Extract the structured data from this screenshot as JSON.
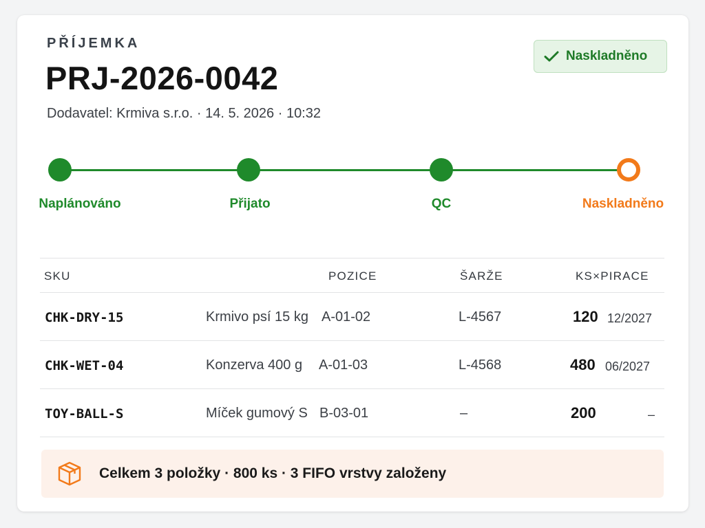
{
  "header": {
    "eyebrow": "PŘÍJEMKA",
    "doc_number": "PRJ-2026-0042",
    "subtitle": "Dodavatel: Krmiva s.r.o. · 14. 5. 2026 · 10:32",
    "status_badge": {
      "label": "Naskladněno",
      "icon": "check-icon",
      "color": "#1e7a27",
      "background": "#e6f4e6"
    }
  },
  "progress": {
    "done_color": "#1f8a2b",
    "current_color": "#f27a1a",
    "steps": [
      {
        "label": "Naplánováno",
        "state": "done"
      },
      {
        "label": "Přijato",
        "state": "done"
      },
      {
        "label": "QC",
        "state": "done"
      },
      {
        "label": "Naskladněno",
        "state": "current"
      }
    ]
  },
  "table": {
    "columns": [
      "SKU",
      "POZICE",
      "ŠARŽE",
      "KS×PIRACE"
    ],
    "rows": [
      {
        "sku": "CHK-DRY-15",
        "name": "Krmivo psí 15 kg",
        "position": "A-01-02",
        "batch": "L-4567",
        "qty": "120",
        "expiry": "12/2027"
      },
      {
        "sku": "CHK-WET-04",
        "name": "Konzerva 400 g",
        "position": "A-01-03",
        "batch": "L-4568",
        "qty": "480",
        "expiry": "06/2027"
      },
      {
        "sku": "TOY-BALL-S",
        "name": "Míček gumový S",
        "position": "B-03-01",
        "batch": "–",
        "qty": "200",
        "expiry": "–"
      }
    ]
  },
  "summary": {
    "icon": "package-icon",
    "text": "Celkem 3 položky · 800 ks · 3 FIFO vrstvy založeny",
    "background": "#fdf1ea",
    "icon_color": "#f27a1a"
  }
}
